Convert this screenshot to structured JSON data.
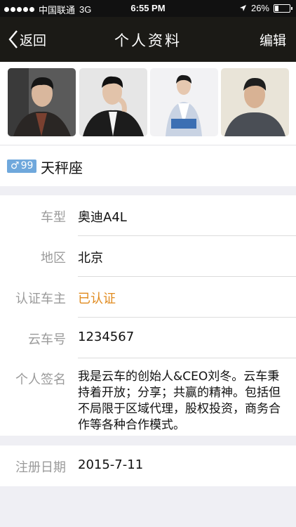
{
  "status_bar": {
    "carrier": "中国联通",
    "network": "3G",
    "time": "6:55 PM",
    "battery": "26%",
    "battery_level": 0.26
  },
  "nav": {
    "back_label": "返回",
    "title": "个人资料",
    "edit_label": "编辑"
  },
  "photos": [
    {
      "icon": "profile-photo-1"
    },
    {
      "icon": "profile-photo-2"
    },
    {
      "icon": "profile-photo-3"
    },
    {
      "icon": "profile-photo-4"
    }
  ],
  "profile": {
    "gender_symbol": "♂",
    "age": "99",
    "zodiac": "天秤座"
  },
  "info": {
    "car_model": {
      "label": "车型",
      "value": "奥迪A4L"
    },
    "region": {
      "label": "地区",
      "value": "北京"
    },
    "verified_owner": {
      "label": "认证车主",
      "value": "已认证"
    },
    "yunche_id": {
      "label": "云车号",
      "value": "1234567"
    },
    "signature": {
      "label": "个人签名",
      "value": "我是云车的创始人&CEO刘冬。云车秉持着开放；分享；共赢的精神。包括但不局限于区域代理，股权投资，商务合作等各种合作模式。"
    }
  },
  "registration": {
    "label": "注册日期",
    "value": "2015-7-11"
  },
  "colors": {
    "nav_bg": "#1b1a16",
    "verified": "#e08a1e",
    "badge": "#6fa8dc",
    "page_bg": "#efeff4"
  }
}
